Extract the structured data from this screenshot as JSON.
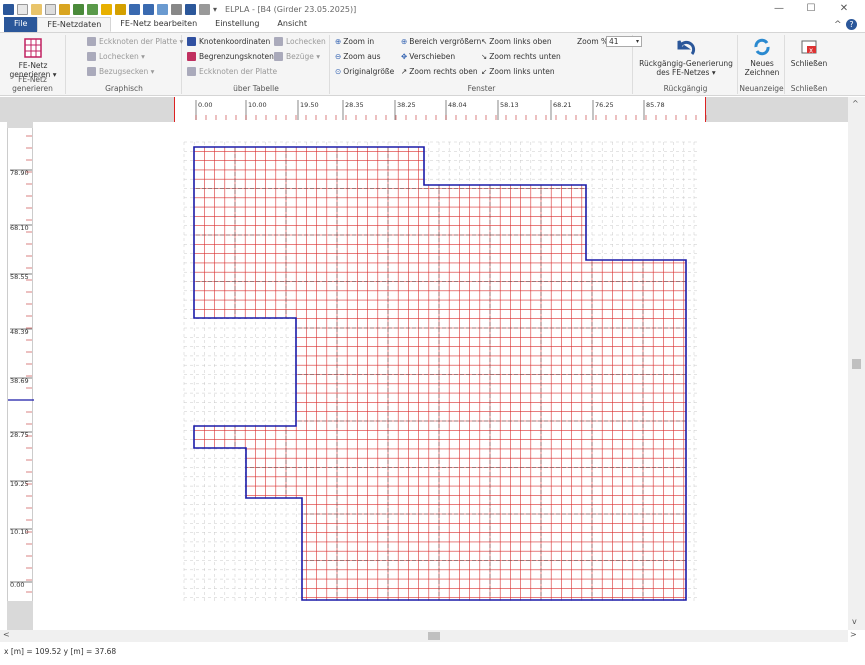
{
  "window": {
    "title": "ELPLA - [B4 (Girder 23.05.2025)]",
    "minimize": "—",
    "maximize": "☐",
    "close": "✕"
  },
  "tabs": [
    "File",
    "FE-Netzdaten",
    "FE-Netz bearbeiten",
    "Einstellung",
    "Ansicht"
  ],
  "ribbon": {
    "fe_netz": {
      "label_line1": "FE-Netz",
      "label_line2": "generieren ▾",
      "group": "FE-Netz generieren"
    },
    "graphisch": {
      "items": [
        "Eckknoten der Platte ▾",
        "Lochecken ▾",
        "Bezugsecken ▾"
      ],
      "group": "Graphisch"
    },
    "tabelle": {
      "items": [
        "Knotenkoordinaten",
        "Begrenzungsknoten",
        "Eckknoten der Platte",
        "Lochecken",
        "Bezüge ▾"
      ],
      "group": "über Tabelle"
    },
    "fenster": {
      "items": [
        "Zoom in",
        "Zoom aus",
        "Originalgröße",
        "Bereich vergrößern",
        "Verschieben",
        "Zoom rechts oben",
        "Zoom links oben",
        "Zoom rechts unten",
        "Zoom links unten"
      ],
      "zoom_label": "Zoom %",
      "zoom_value": "41",
      "group": "Fenster"
    },
    "rueckgaengig": {
      "label_line1": "Rückgängig-Generierung",
      "label_line2": "des FE-Netzes ▾",
      "group": "Rückgängig"
    },
    "neuanzeige": {
      "label_line1": "Neues",
      "label_line2": "Zeichnen",
      "group": "Neuanzeige"
    },
    "schliessen": {
      "label": "Schließen",
      "group": "Schließen"
    }
  },
  "ruler_top": [
    "0.00",
    "10.00",
    "19.50",
    "28.35",
    "38.25",
    "48.04",
    "58.13",
    "68.21",
    "76.25",
    "85.78"
  ],
  "ruler_left": [
    "78.90",
    "68.10",
    "58.55",
    "48.39",
    "38.69",
    "28.75",
    "19.25",
    "10.10",
    "0.00"
  ],
  "status": {
    "text": "x [m] = 109.52   y [m] = 37.68"
  },
  "colors": {
    "accent": "#2b579a",
    "mesh": "#d93030",
    "boundary": "#1a1aa8",
    "ruler_marker": "#dd2222"
  }
}
